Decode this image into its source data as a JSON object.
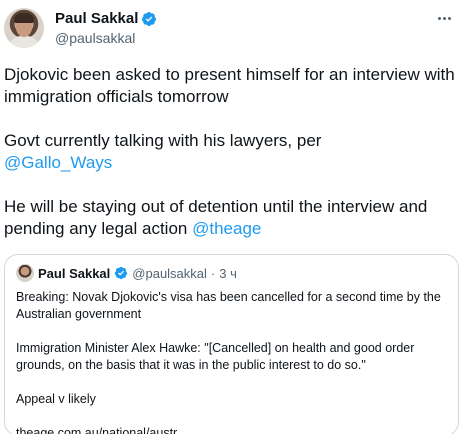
{
  "author": {
    "name": "Paul Sakkal",
    "handle": "@paulsakkal",
    "verified_color": "#1d9bf0"
  },
  "tweet": {
    "line1": "Djokovic been asked to present himself for an interview with immigration officials tomorrow",
    "line2_text": "Govt currently talking with his lawyers, per",
    "line2_mention": "@Gallo_Ways",
    "line3_text": "He will be staying out of detention until the interview and pending any legal action",
    "line3_mention": "@theage"
  },
  "quote": {
    "name": "Paul Sakkal",
    "handle": "@paulsakkal",
    "dot": "·",
    "time": "3 ч",
    "para1": "Breaking: Novak Djokovic's visa has been cancelled for a second time by the Australian government",
    "para2": "Immigration Minister Alex Hawke: \"[Cancelled] on health and good order grounds, on the basis that it was in the public interest to do so.\"",
    "para3": "Appeal v likely",
    "link": "theage.com.au/national/austr…"
  },
  "icons": {
    "more": "more-horizontal-icon",
    "verified": "verified-badge-icon"
  },
  "colors": {
    "text": "#0f1419",
    "secondary": "#536471",
    "accent": "#1d9bf0",
    "border": "#cfd9de"
  }
}
